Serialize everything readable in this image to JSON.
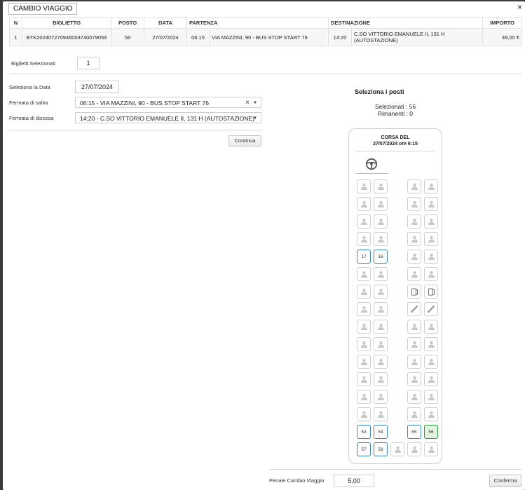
{
  "dialog": {
    "title": "CAMBIO VIAGGIO",
    "close": "×"
  },
  "table": {
    "headers": {
      "n": "N",
      "biglietto": "BIGLIETTO",
      "posto": "POSTO",
      "data": "DATA",
      "partenza": "PARTENZA",
      "destinazione": "DESTINAZIONE",
      "importo": "IMPORTO"
    },
    "row": {
      "n": "1",
      "biglietto": "BTK20240727094600374007905​4",
      "posto": "56",
      "data": "27/07/2024",
      "ora_partenza": "06:15",
      "partenza": "VIA MAZZINI, 90 - BUS STOP START 76",
      "ora_arrivo": "14:20",
      "destinazione": "C.SO VITTORIO EMANUELE II, 131 H (AUTOSTAZIONE)",
      "importo": "49,00 €"
    }
  },
  "selection": {
    "label": "Biglietti Selezionati",
    "count": "1"
  },
  "form": {
    "date_label": "Seleziona la Data",
    "date_value": "27/07/2024",
    "salita_label": "Fermata di salita",
    "salita_value": "06:15 - VIA MAZZINI, 90 - BUS STOP START 76",
    "discesa_label": "Fermata di discesa",
    "discesa_value": "14:20 - C.SO VITTORIO EMANUELE II, 131 H (AUTOSTAZIONE)",
    "continue_label": "Continua"
  },
  "seats_panel": {
    "title": "Seleziona i posti",
    "selected": "Selezionati : 56",
    "remaining": "Rimanenti : 0",
    "bus_header_line1": "CORSA DEL",
    "bus_header_line2": "27/07/2024 ore 6:15"
  },
  "seats": [
    {
      "row": 1,
      "col": 1,
      "type": "taken"
    },
    {
      "row": 1,
      "col": 2,
      "type": "taken"
    },
    {
      "row": 1,
      "col": 4,
      "type": "taken"
    },
    {
      "row": 1,
      "col": 5,
      "type": "taken"
    },
    {
      "row": 2,
      "col": 1,
      "type": "taken"
    },
    {
      "row": 2,
      "col": 2,
      "type": "taken"
    },
    {
      "row": 2,
      "col": 4,
      "type": "taken"
    },
    {
      "row": 2,
      "col": 5,
      "type": "taken"
    },
    {
      "row": 3,
      "col": 1,
      "type": "taken"
    },
    {
      "row": 3,
      "col": 2,
      "type": "taken"
    },
    {
      "row": 3,
      "col": 4,
      "type": "taken"
    },
    {
      "row": 3,
      "col": 5,
      "type": "taken"
    },
    {
      "row": 4,
      "col": 1,
      "type": "taken"
    },
    {
      "row": 4,
      "col": 2,
      "type": "taken"
    },
    {
      "row": 4,
      "col": 4,
      "type": "taken"
    },
    {
      "row": 4,
      "col": 5,
      "type": "taken"
    },
    {
      "row": 5,
      "col": 1,
      "type": "free",
      "num": "17"
    },
    {
      "row": 5,
      "col": 2,
      "type": "free",
      "num": "18"
    },
    {
      "row": 5,
      "col": 4,
      "type": "taken"
    },
    {
      "row": 5,
      "col": 5,
      "type": "taken"
    },
    {
      "row": 6,
      "col": 1,
      "type": "taken"
    },
    {
      "row": 6,
      "col": 2,
      "type": "taken"
    },
    {
      "row": 6,
      "col": 4,
      "type": "taken"
    },
    {
      "row": 6,
      "col": 5,
      "type": "taken"
    },
    {
      "row": 7,
      "col": 1,
      "type": "taken"
    },
    {
      "row": 7,
      "col": 2,
      "type": "taken"
    },
    {
      "row": 7,
      "col": 4,
      "type": "door"
    },
    {
      "row": 7,
      "col": 5,
      "type": "door"
    },
    {
      "row": 8,
      "col": 1,
      "type": "taken"
    },
    {
      "row": 8,
      "col": 2,
      "type": "taken"
    },
    {
      "row": 8,
      "col": 4,
      "type": "stairs"
    },
    {
      "row": 8,
      "col": 5,
      "type": "stairs"
    },
    {
      "row": 9,
      "col": 1,
      "type": "taken"
    },
    {
      "row": 9,
      "col": 2,
      "type": "taken"
    },
    {
      "row": 9,
      "col": 4,
      "type": "taken"
    },
    {
      "row": 9,
      "col": 5,
      "type": "taken"
    },
    {
      "row": 10,
      "col": 1,
      "type": "taken"
    },
    {
      "row": 10,
      "col": 2,
      "type": "taken"
    },
    {
      "row": 10,
      "col": 4,
      "type": "taken"
    },
    {
      "row": 10,
      "col": 5,
      "type": "taken"
    },
    {
      "row": 11,
      "col": 1,
      "type": "taken"
    },
    {
      "row": 11,
      "col": 2,
      "type": "taken"
    },
    {
      "row": 11,
      "col": 4,
      "type": "taken"
    },
    {
      "row": 11,
      "col": 5,
      "type": "taken"
    },
    {
      "row": 12,
      "col": 1,
      "type": "taken"
    },
    {
      "row": 12,
      "col": 2,
      "type": "taken"
    },
    {
      "row": 12,
      "col": 4,
      "type": "taken"
    },
    {
      "row": 12,
      "col": 5,
      "type": "taken"
    },
    {
      "row": 13,
      "col": 1,
      "type": "taken"
    },
    {
      "row": 13,
      "col": 2,
      "type": "taken"
    },
    {
      "row": 13,
      "col": 4,
      "type": "taken"
    },
    {
      "row": 13,
      "col": 5,
      "type": "taken"
    },
    {
      "row": 14,
      "col": 1,
      "type": "taken"
    },
    {
      "row": 14,
      "col": 2,
      "type": "taken"
    },
    {
      "row": 14,
      "col": 4,
      "type": "taken"
    },
    {
      "row": 14,
      "col": 5,
      "type": "taken"
    },
    {
      "row": 15,
      "col": 1,
      "type": "free",
      "num": "53"
    },
    {
      "row": 15,
      "col": 2,
      "type": "free",
      "num": "54"
    },
    {
      "row": 15,
      "col": 4,
      "type": "free",
      "num": "55"
    },
    {
      "row": 15,
      "col": 5,
      "type": "selected",
      "num": "56"
    },
    {
      "row": 16,
      "col": 1,
      "type": "free",
      "num": "57"
    },
    {
      "row": 16,
      "col": 2,
      "type": "free",
      "num": "58"
    },
    {
      "row": 16,
      "col": 3,
      "type": "taken"
    },
    {
      "row": 16,
      "col": 4,
      "type": "taken"
    },
    {
      "row": 16,
      "col": 5,
      "type": "taken"
    }
  ],
  "penale": {
    "label": "Penale Cambio Viaggio",
    "value": "5.00"
  },
  "confirm_label": "Conferma",
  "colors": {
    "free": "#3a86b8",
    "selected": "#2e9a3b",
    "taken": "#cfcfcf"
  },
  "icons": {
    "taken": "person-icon",
    "door": "door-icon",
    "stairs": "stairs-icon",
    "driver": "steering-wheel-icon"
  }
}
